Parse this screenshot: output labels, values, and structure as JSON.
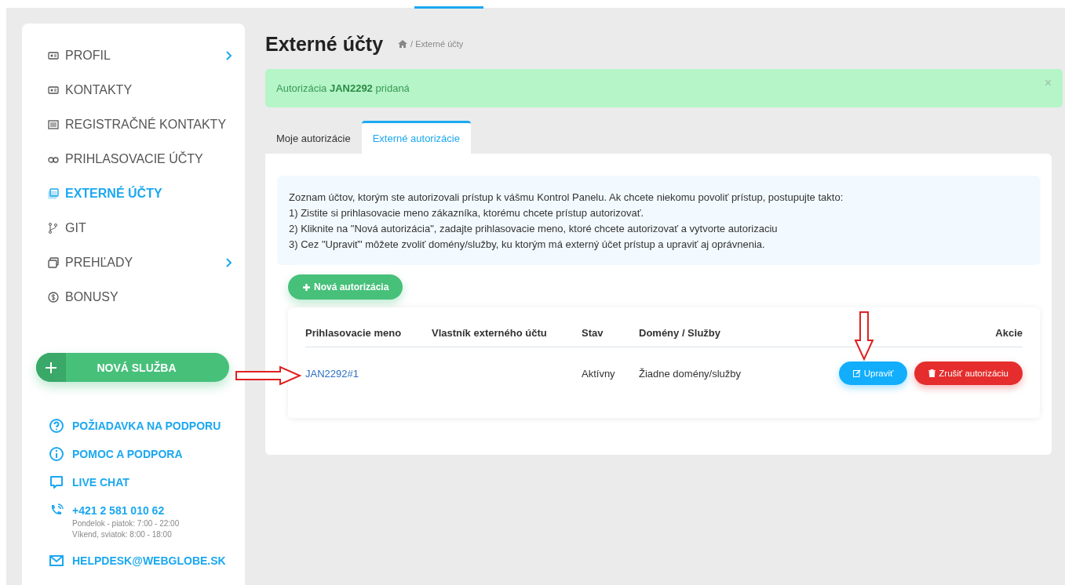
{
  "sidebar": {
    "menu": [
      {
        "label": "PROFIL",
        "selected": false,
        "has_submenu": true
      },
      {
        "label": "KONTAKTY",
        "selected": false,
        "has_submenu": false
      },
      {
        "label": "REGISTRAČNÉ KONTAKTY",
        "selected": false,
        "has_submenu": false
      },
      {
        "label": "PRIHLASOVACIE ÚČTY",
        "selected": false,
        "has_submenu": false
      },
      {
        "label": "EXTERNÉ ÚČTY",
        "selected": true,
        "has_submenu": false
      },
      {
        "label": "GIT",
        "selected": false,
        "has_submenu": false
      },
      {
        "label": "PREHĽADY",
        "selected": false,
        "has_submenu": true
      },
      {
        "label": "BONUSY",
        "selected": false,
        "has_submenu": false
      }
    ],
    "new_service_button": {
      "label": "NOVÁ SLUŽBA"
    },
    "support_links": [
      {
        "kind": "help",
        "label": "POŽIADAVKA NA PODPORU"
      },
      {
        "kind": "info",
        "label": "POMOC A PODPORA"
      },
      {
        "kind": "chat",
        "label": "LIVE CHAT"
      },
      {
        "kind": "phone",
        "label": "+421 2 581 010 62",
        "notes": [
          "Pondelok - piatok: 7:00 - 22:00",
          "Víkend, sviatok: 8:00 - 18:00"
        ]
      },
      {
        "kind": "mail",
        "label": "HELPDESK@WEBGLOBE.SK"
      }
    ]
  },
  "page": {
    "title": "Externé účty",
    "breadcrumb": "/ Externé účty"
  },
  "alert": {
    "text": "Autorizácia **JAN2292** pridaná",
    "close": "×"
  },
  "tabs": [
    {
      "label": "Moje autorizácie",
      "selected": false
    },
    {
      "label": "Externé autorizácie",
      "selected": true
    }
  ],
  "info": [
    "Zoznam účtov, ktorým ste autorizovali prístup k vášmu Kontrol Panelu. Ak chcete niekomu povoliť prístup, postupujte takto:",
    "1) Zistite si prihlasovacie meno zákazníka, ktorému chcete prístup autorizovať.",
    "2) Kliknite na \"Nová autorizácia\", zadajte prihlasovacie meno, ktoré chcete autorizovať a vytvorte autorizaciu",
    "3) Cez \"Upraviť\" môžete zvoliť domény/služby, ku ktorým má externý účet prístup a upraviť aj oprávnenia."
  ],
  "add_button": {
    "label": "Nová autorizácia"
  },
  "table": {
    "columns": [
      "Prihlasovacie meno",
      "Vlastník externého účtu",
      "Stav",
      "Domény / Služby",
      "Akcie"
    ],
    "rows": [
      {
        "login": "JAN2292#1",
        "status": "Aktívny",
        "domains": "Žiadne domény/služby",
        "actions": [
          {
            "kind": "edit",
            "label": "Upraviť"
          },
          {
            "kind": "delete",
            "label": "Zrušiť autorizáciu"
          }
        ]
      }
    ]
  }
}
